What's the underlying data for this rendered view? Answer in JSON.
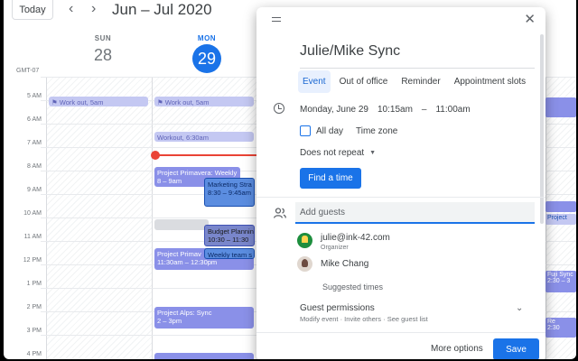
{
  "toolbar": {
    "today_label": "Today",
    "prev_icon": "chevron-left-icon",
    "next_icon": "chevron-right-icon",
    "range_title": "Jun – Jul 2020"
  },
  "days": [
    {
      "dow": "SUN",
      "num": "28"
    },
    {
      "dow": "MON",
      "num": "29"
    }
  ],
  "timezone_label": "GMT-07",
  "hours": [
    "5 AM",
    "6 AM",
    "7 AM",
    "8 AM",
    "9 AM",
    "10 AM",
    "11 AM",
    "12 PM",
    "1 PM",
    "2 PM",
    "3 PM",
    "4 PM"
  ],
  "events": {
    "sun_workout": "⚑ Work out, 5am",
    "mon_workout": "⚑ Work out, 5am",
    "mon_workout2": "Workout, 6:30am",
    "primavera_title": "Project Primavera: Weekly",
    "primavera_time": "8 – 9am",
    "marketing_title": "Marketing Stra",
    "marketing_time": "8:30 – 9:45am",
    "budget_title": "Budget Planning",
    "budget_time": "10:30 – 11:30",
    "primav2_title": "Project Primav",
    "primav2_time": "11:30am – 12:30pm",
    "weekly_title": "Weekly team s",
    "alps_title": "Project Alps: Sync",
    "alps_time": "2 – 3pm",
    "edge_project": "Project",
    "edge_fuji": "Fuji Sync",
    "edge_fuji_time": "2:30 – 3",
    "edge_re": "Re",
    "edge_re_time": "2:30"
  },
  "dialog": {
    "title": "Julie/Mike Sync",
    "tabs": [
      "Event",
      "Out of office",
      "Reminder",
      "Appointment slots"
    ],
    "date": "Monday, June 29",
    "start": "10:15am",
    "dash": "–",
    "end": "11:00am",
    "all_day": "All day",
    "time_zone": "Time zone",
    "repeat": "Does not repeat",
    "find_time": "Find a time",
    "guests_placeholder": "Add guests",
    "guests": [
      {
        "name": "julie@ink-42.com",
        "role": "Organizer"
      },
      {
        "name": "Mike Chang",
        "role": ""
      }
    ],
    "suggested_times": "Suggested times",
    "permissions_title": "Guest permissions",
    "permissions_sub": "Modify event · Invite others · See guest list",
    "more_options": "More options",
    "save": "Save"
  }
}
